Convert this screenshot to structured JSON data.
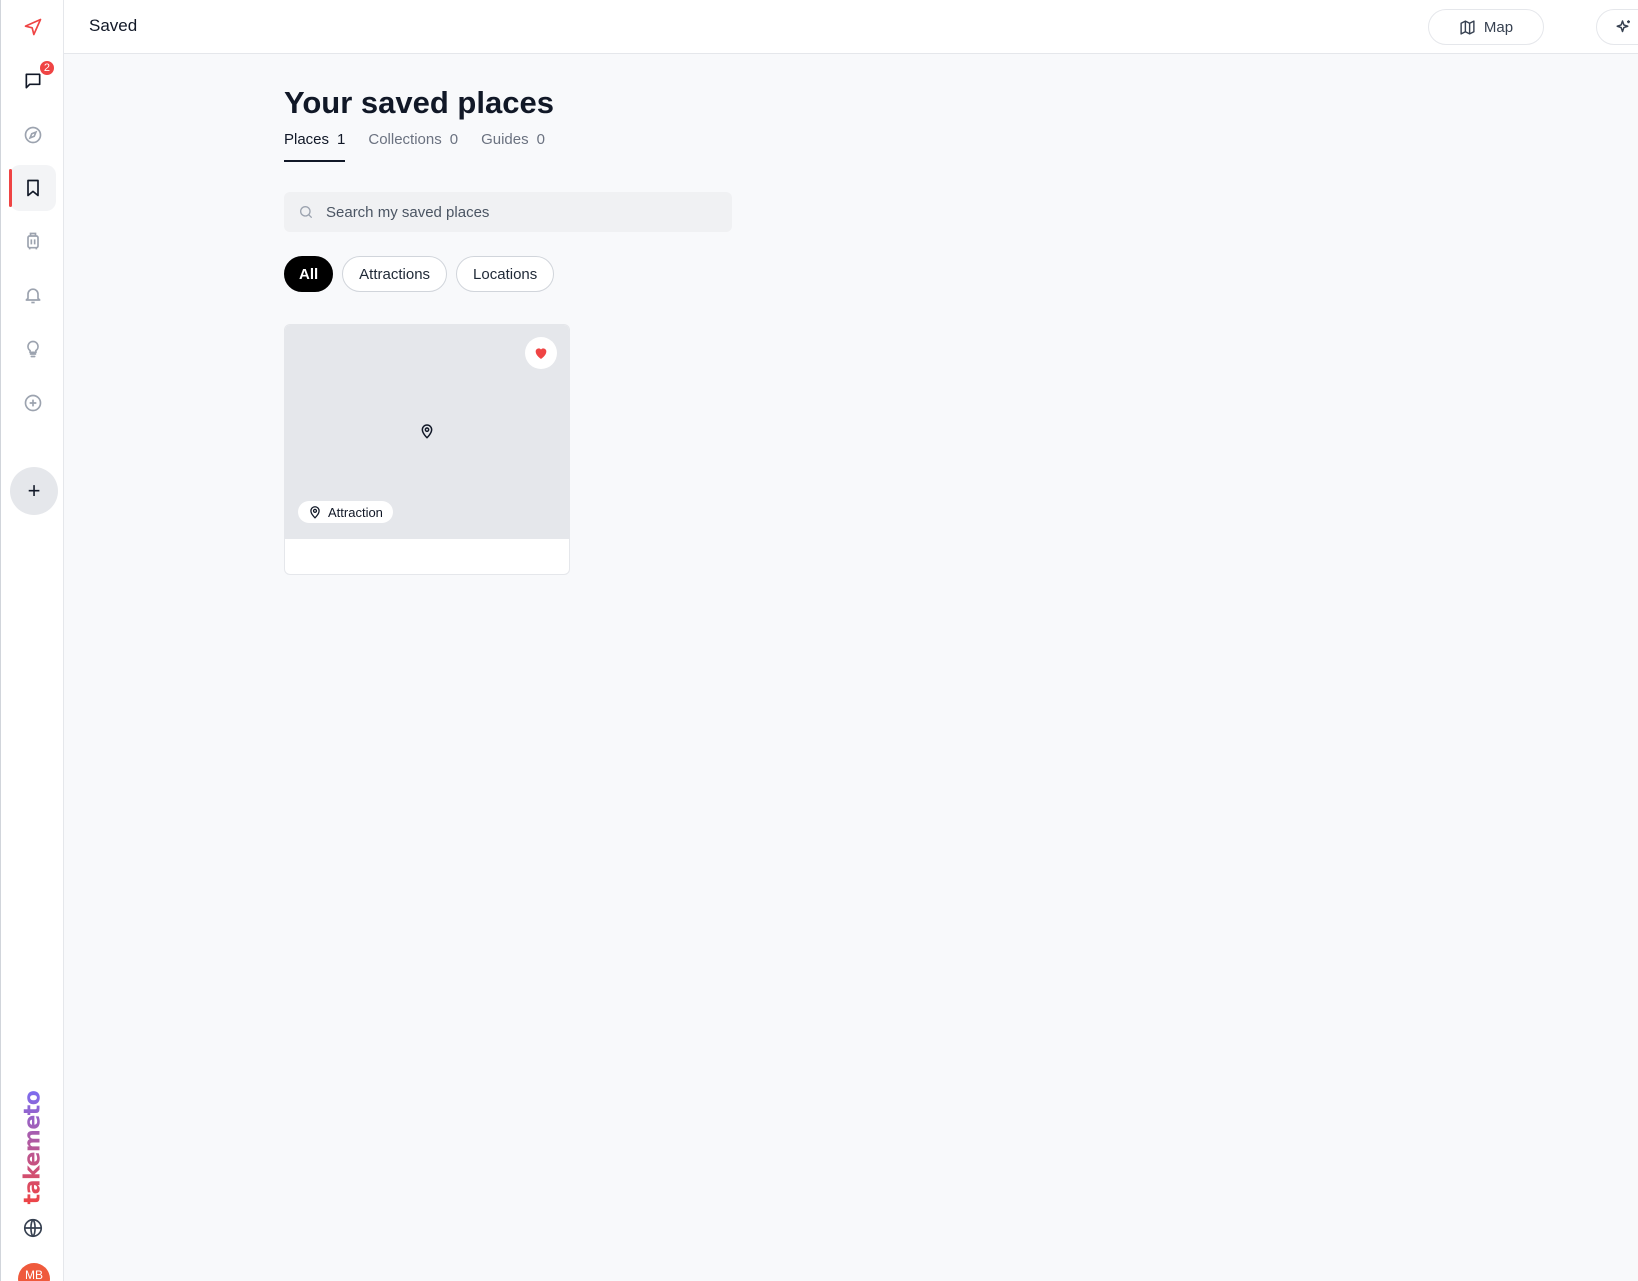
{
  "topbar": {
    "title": "Saved",
    "map_label": "Map"
  },
  "sidebar": {
    "items": [
      {
        "name": "send",
        "icon": "send-icon"
      },
      {
        "name": "messages",
        "icon": "message-icon",
        "badge": "2"
      },
      {
        "name": "explore",
        "icon": "compass-icon"
      },
      {
        "name": "saved",
        "icon": "bookmark-icon",
        "active": true
      },
      {
        "name": "trips",
        "icon": "luggage-icon"
      },
      {
        "name": "notifications",
        "icon": "bell-icon"
      },
      {
        "name": "ideas",
        "icon": "lightbulb-icon"
      },
      {
        "name": "create",
        "icon": "plus-circle-icon"
      }
    ],
    "logo": "takemeto",
    "avatar_initials": "MB"
  },
  "main": {
    "title": "Your saved places",
    "tabs": [
      {
        "label": "Places",
        "count": "1",
        "active": true
      },
      {
        "label": "Collections",
        "count": "0"
      },
      {
        "label": "Guides",
        "count": "0"
      }
    ],
    "search": {
      "placeholder": "Search my saved places",
      "value": ""
    },
    "filters": [
      {
        "label": "All",
        "active": true
      },
      {
        "label": "Attractions"
      },
      {
        "label": "Locations"
      }
    ],
    "cards": [
      {
        "type_label": "Attraction",
        "favorited": true
      }
    ]
  },
  "colors": {
    "accent": "#ef4444",
    "brand_gradient_end": "#7c6cf0",
    "background": "#f8f9fb"
  }
}
